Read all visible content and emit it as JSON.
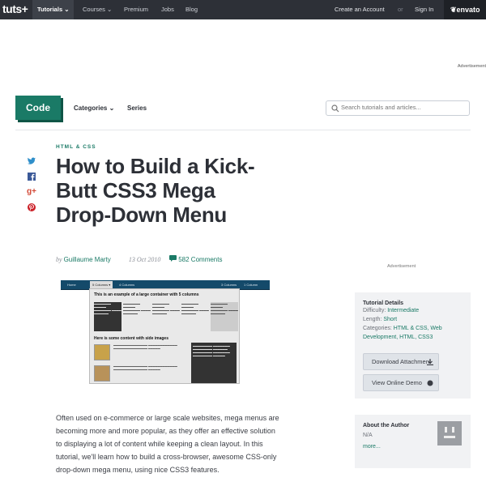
{
  "topbar": {
    "logo": "tuts+",
    "nav": [
      {
        "label": "Tutorials ⌄"
      },
      {
        "label": "Courses ⌄"
      },
      {
        "label": "Premium"
      },
      {
        "label": "Jobs"
      },
      {
        "label": "Blog"
      }
    ],
    "create_account": "Create an Account",
    "or": "or",
    "sign_in": "Sign In",
    "envato": "envato"
  },
  "ad_top": "Advertisement",
  "header": {
    "code_tab": "Code",
    "categories": "Categories ⌄",
    "series": "Series",
    "search_placeholder": "Search tutorials and articles..."
  },
  "article": {
    "category": "HTML & CSS",
    "title": "How to Build a Kick-Butt CSS3 Mega Drop-Down Menu",
    "by": "by",
    "author": "Guillaume Marty",
    "date": "13 Oct 2010",
    "comments": "582 Comments",
    "intro": "Often used on e-commerce or large scale websites, mega menus are becoming more and more popular, as they offer an effective solution to displaying a lot of content while keeping a clean layout. In this tutorial, we'll learn how to build a cross-browser, awesome CSS-only drop-down mega menu, using nice CSS3 features."
  },
  "preview": {
    "tabs": [
      "Home",
      "5 Columns ▾",
      "4 Columns",
      "3 Columns",
      "1 Column"
    ],
    "heading1": "This is an example of a large container with 5 columns",
    "heading2": "Here is some content with side images"
  },
  "ad_mid": "Advertisement",
  "tutorial_details": {
    "title": "Tutorial Details",
    "difficulty_label": "Difficulty:",
    "difficulty": "Intermediate",
    "length_label": "Length:",
    "length": "Short",
    "categories_label": "Categories:",
    "categories": "HTML & CSS, Web Development, HTML, CSS3",
    "download_btn": "Download Attachment",
    "demo_btn": "View Online Demo"
  },
  "about_author": {
    "title": "About the Author",
    "na": "N/A",
    "more": "more..."
  },
  "colors": {
    "topbar": "#2d3037",
    "brand": "#1a7a66"
  }
}
